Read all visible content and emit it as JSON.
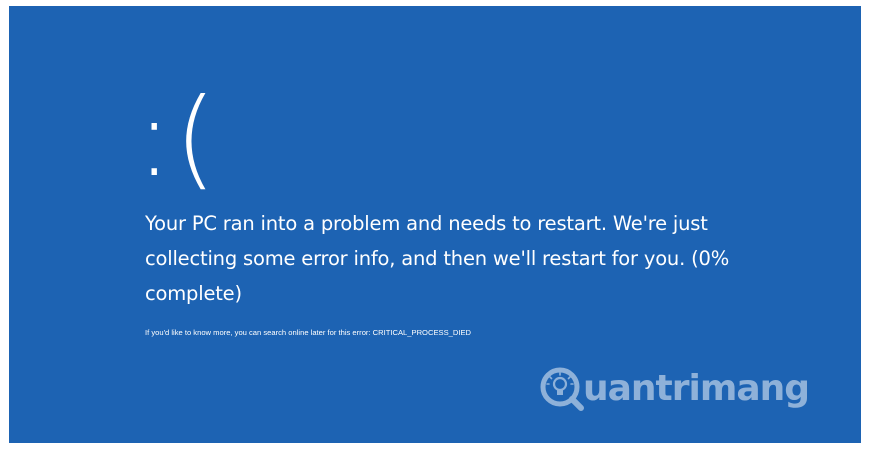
{
  "screen": {
    "background_color": "#1d63b3",
    "text_color": "#ffffff"
  },
  "sad_face": ":(",
  "message": "Your PC ran into a problem and needs to restart. We're just collecting some error info, and then we'll restart for you. (0% complete)",
  "more_info": "If you'd like to know more, you can search online later for this error: CRITICAL_PROCESS_DIED",
  "watermark": {
    "logo_icon": "lightbulb-q-logo-icon",
    "text": "uantrimang"
  }
}
